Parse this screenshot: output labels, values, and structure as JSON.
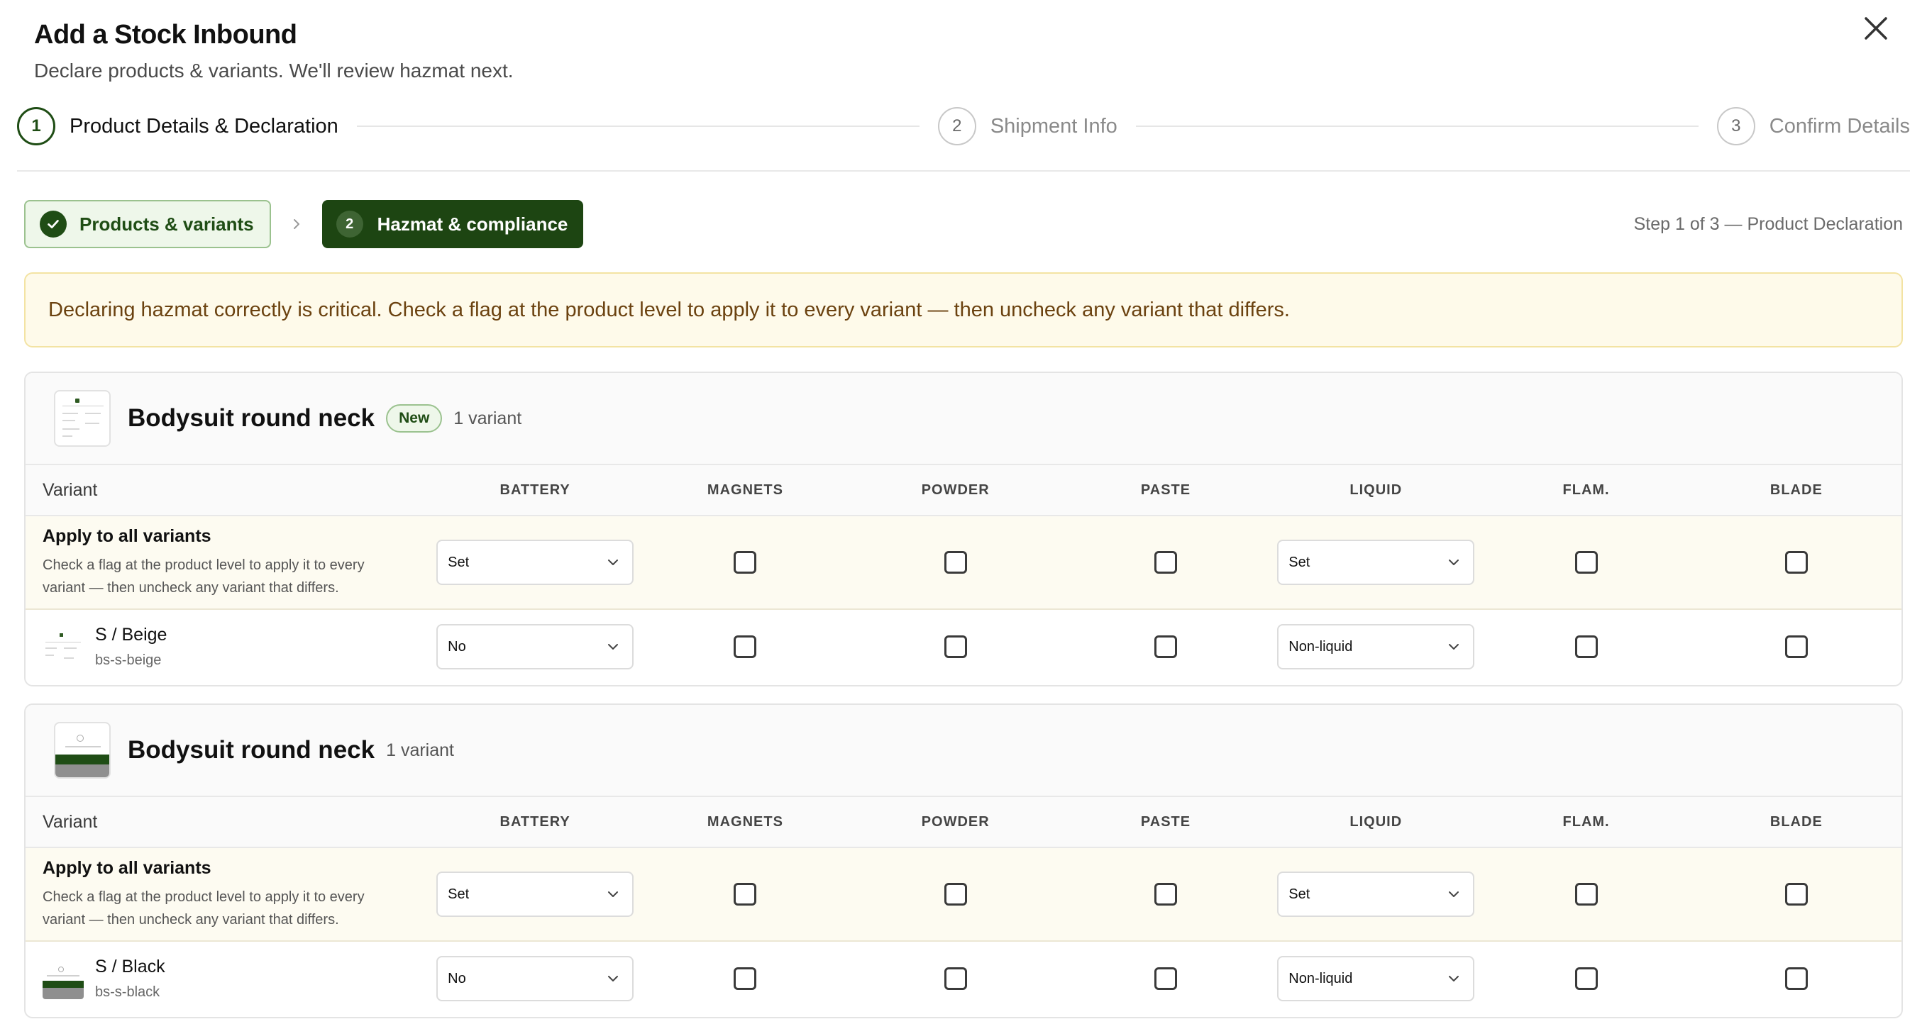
{
  "header": {
    "title": "Add a Stock Inbound",
    "subtitle": "Declare products & variants. We'll review hazmat next."
  },
  "stepper": [
    {
      "number": "1",
      "label": "Product Details & Declaration"
    },
    {
      "number": "2",
      "label": "Shipment Info"
    },
    {
      "number": "3",
      "label": "Confirm Details"
    }
  ],
  "substeps": {
    "done_label": "Products & variants",
    "active_number": "2",
    "active_label": "Hazmat & compliance",
    "note": "Step 1 of 3 — Product Declaration"
  },
  "alert": {
    "text": "Declaring hazmat correctly is critical. Check a flag at the product level to apply it to every variant — then uncheck any variant that differs."
  },
  "columns": {
    "variant": "Variant",
    "battery": "BATTERY",
    "magnets": "MAGNETS",
    "powder": "POWDER",
    "paste": "PASTE",
    "liquid": "LIQUID",
    "flam": "FLAM.",
    "blade": "BLADE"
  },
  "apply_row": {
    "title": "Apply to all variants",
    "desc": "Check a flag at the product level to apply it to every variant — then uncheck any variant that differs."
  },
  "products": [
    {
      "name": "Bodysuit round neck",
      "badge": "New",
      "variant_count": "1 variant",
      "apply": {
        "battery": "Set",
        "liquid": "Set"
      },
      "variant": {
        "name": "S / Beige",
        "sku": "bs-s-beige",
        "battery": "No",
        "liquid": "Non-liquid"
      }
    },
    {
      "name": "Bodysuit round neck",
      "variant_count": "1 variant",
      "apply": {
        "battery": "Set",
        "liquid": "Set"
      },
      "variant": {
        "name": "S / Black",
        "sku": "bs-s-black",
        "battery": "No",
        "liquid": "Non-liquid"
      }
    }
  ],
  "colors": {
    "brand_green": "#1d4512",
    "done_bg": "#eef7ea",
    "alert_bg": "#fefaea",
    "alert_text": "#6b4210"
  }
}
